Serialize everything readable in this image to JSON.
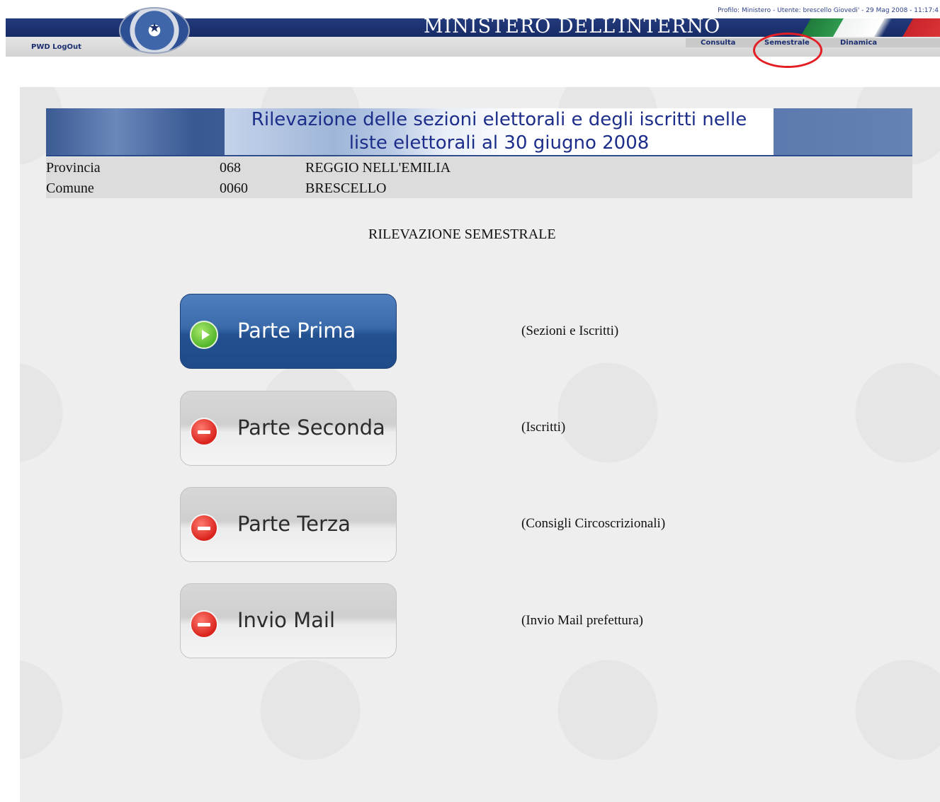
{
  "header": {
    "profile_line": "Profilo: Ministero - Utente: brescello  Giovedi' - 29 Mag 2008 - 11:17:4",
    "ministry_title": "MINISTERO DELL’INTERNO",
    "logout_label": "PWD LogOut",
    "nav": {
      "consulta": "Consulta",
      "semestrale": "Semestrale",
      "dinamica": "Dinamica"
    },
    "highlighted_nav": "Semestrale",
    "highlight_color": "#e31e24"
  },
  "banner": {
    "title_line1": "Rilevazione delle sezioni elettorali e degli iscritti nelle",
    "title_line2": "liste elettorali al 30 giugno 2008"
  },
  "info": {
    "provincia_label": "Provincia",
    "provincia_code": "068",
    "provincia_name": "REGGIO NELL'EMILIA",
    "comune_label": "Comune",
    "comune_code": "0060",
    "comune_name": "BRESCELLO"
  },
  "section_title": "RILEVAZIONE SEMESTRALE",
  "actions": [
    {
      "label": "Parte Prima",
      "description": "(Sezioni e Iscritti)",
      "state": "active",
      "icon": "play-icon"
    },
    {
      "label": "Parte Seconda",
      "description": "(Iscritti)",
      "state": "disabled",
      "icon": "minus-icon"
    },
    {
      "label": "Parte Terza",
      "description": "(Consigli Circoscrizionali)",
      "state": "disabled",
      "icon": "minus-icon"
    },
    {
      "label": "Invio Mail",
      "description": "(Invio Mail prefettura)",
      "state": "disabled",
      "icon": "minus-icon"
    }
  ],
  "colors": {
    "header_blue": "#172c66",
    "active_button": "#2f5f9f",
    "banner_text": "#1d2e8a"
  }
}
